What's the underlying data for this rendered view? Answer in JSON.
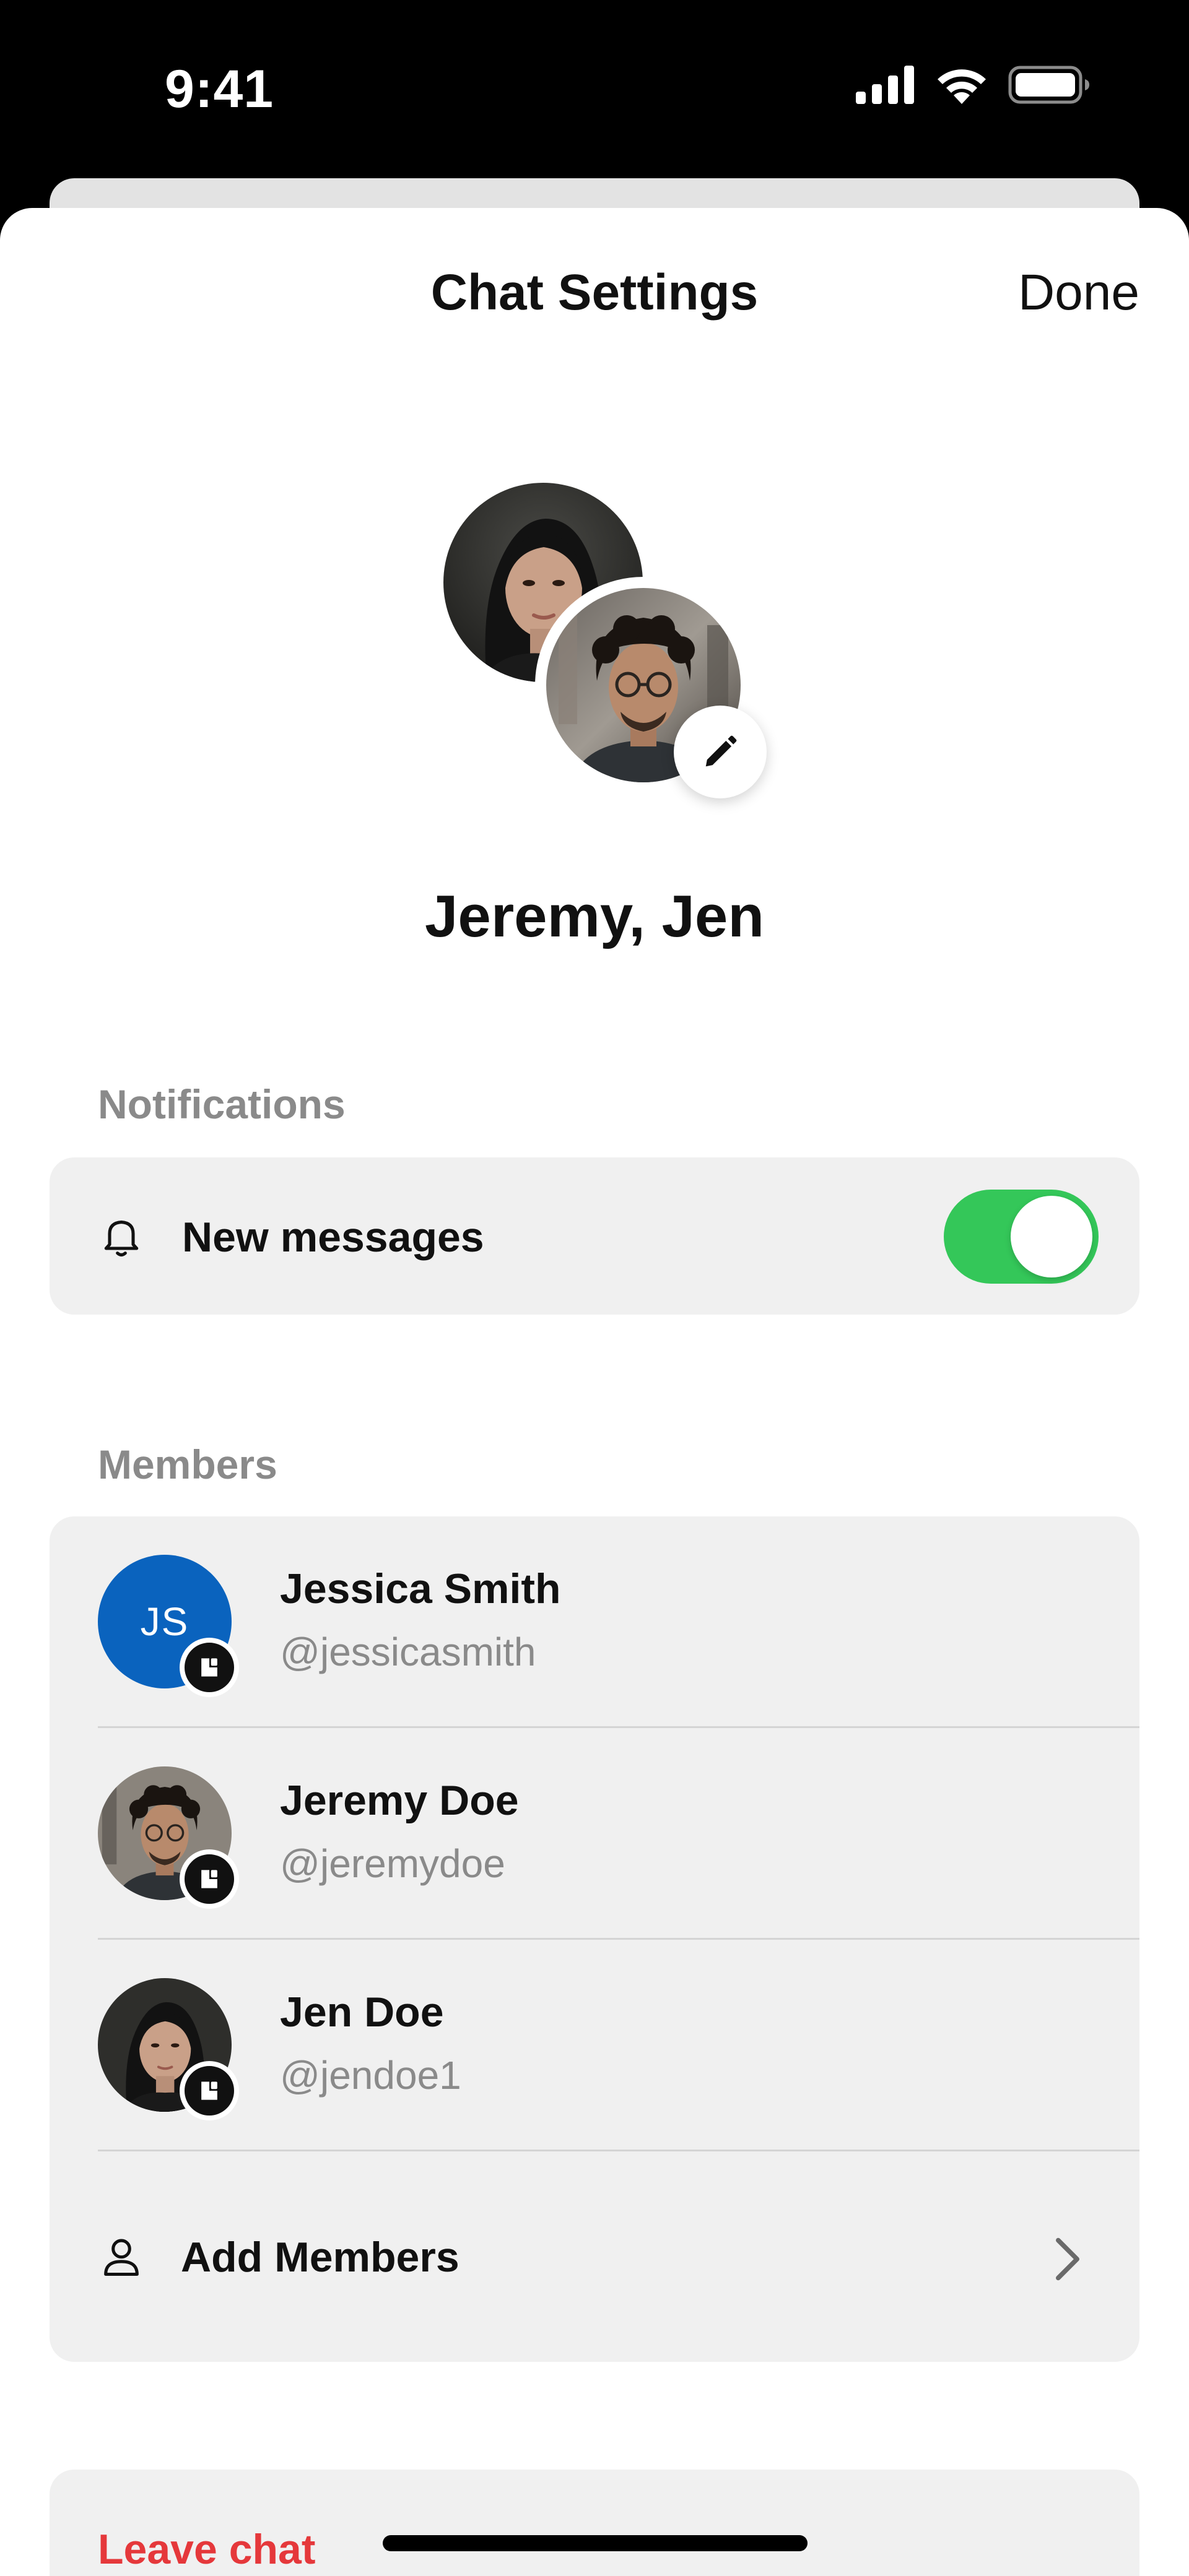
{
  "status_bar": {
    "time": "9:41",
    "icons": [
      "signal-icon",
      "wifi-icon",
      "battery-icon"
    ]
  },
  "header": {
    "title": "Chat Settings",
    "done_label": "Done"
  },
  "chat": {
    "name": "Jeremy, Jen",
    "edit_icon": "pencil-icon"
  },
  "notifications": {
    "section_label": "Notifications",
    "new_messages_label": "New messages",
    "new_messages_enabled": true,
    "icon": "bell-icon"
  },
  "members": {
    "section_label": "Members",
    "items": [
      {
        "name": "Jessica Smith",
        "handle": "@jessicasmith",
        "initials": "JS"
      },
      {
        "name": "Jeremy Doe",
        "handle": "@jeremydoe"
      },
      {
        "name": "Jen Doe",
        "handle": "@jendoe1"
      }
    ],
    "add_label": "Add Members",
    "add_icon": "person-icon",
    "chevron_icon": "chevron-right-icon"
  },
  "actions": {
    "leave_label": "Leave chat"
  },
  "colors": {
    "accent_green": "#34c759",
    "destructive_red": "#e5383b",
    "initials_blue": "#0a63be",
    "card_bg": "#f0f0f0",
    "muted_text": "#8a8a8a"
  }
}
